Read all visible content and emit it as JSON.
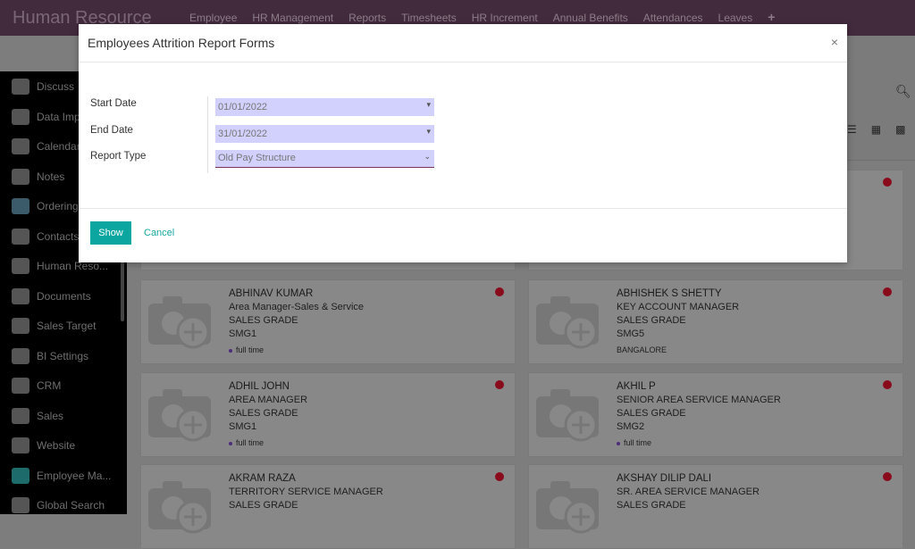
{
  "app": {
    "title": "Human Resource",
    "menu": [
      "Employee",
      "HR Management",
      "Reports",
      "Timesheets",
      "HR Increment",
      "Annual Benefits",
      "Attendances",
      "Leaves"
    ],
    "add_icon": "+"
  },
  "sidebar": {
    "items": [
      {
        "label": "Discuss",
        "icon": "camera-icon"
      },
      {
        "label": "Data Imp",
        "icon": "camera-icon"
      },
      {
        "label": "Calendar",
        "icon": "camera-icon"
      },
      {
        "label": "Notes",
        "icon": "camera-icon"
      },
      {
        "label": "Ordering",
        "icon": "handshake-icon"
      },
      {
        "label": "Contacts",
        "icon": "camera-icon"
      },
      {
        "label": "Human Reso...",
        "icon": "camera-icon"
      },
      {
        "label": "Documents",
        "icon": "camera-icon"
      },
      {
        "label": "Sales Target",
        "icon": "camera-icon"
      },
      {
        "label": "BI Settings",
        "icon": "camera-icon"
      },
      {
        "label": "CRM",
        "icon": "camera-icon"
      },
      {
        "label": "Sales",
        "icon": "camera-icon"
      },
      {
        "label": "Website",
        "icon": "camera-icon"
      },
      {
        "label": "Employee Ma...",
        "icon": "map-pin-icon"
      },
      {
        "label": "Global Search",
        "icon": "camera-icon"
      }
    ]
  },
  "employees": [
    {
      "name": "ABHINAV KUMAR",
      "job": "Area Manager-Sales & Service",
      "grade": "SALES GRADE",
      "code": "SMG1",
      "tag": "full time"
    },
    {
      "name": "ABHISHEK S SHETTY",
      "job": "KEY ACCOUNT MANAGER",
      "grade": "SALES GRADE",
      "code": "SMG5",
      "tag": "BANGALORE"
    },
    {
      "name": "ADHIL JOHN",
      "job": "AREA MANAGER",
      "grade": "SALES GRADE",
      "code": "SMG1",
      "tag": "full time"
    },
    {
      "name": "AKHIL P",
      "job": "SENIOR AREA SERVICE MANAGER",
      "grade": "SALES GRADE",
      "code": "SMG2",
      "tag": "full time"
    },
    {
      "name": "AKRAM RAZA",
      "job": "TERRITORY SERVICE MANAGER",
      "grade": "SALES GRADE",
      "code": "",
      "tag": ""
    },
    {
      "name": "AKSHAY DILIP DALI",
      "job": "SR. AREA SERVICE MANAGER",
      "grade": "SALES GRADE",
      "code": "",
      "tag": ""
    }
  ],
  "modal": {
    "title": "Employees Attrition Report Forms",
    "close": "×",
    "start_label": "Start Date",
    "start_value": "01/01/2022",
    "end_label": "End Date",
    "end_value": "31/01/2022",
    "type_label": "Report Type",
    "type_value": "Old Pay Structure",
    "show": "Show",
    "cancel": "Cancel"
  },
  "colors": {
    "topbar": "#432b3e",
    "primary": "#0ba6a0",
    "status_red": "#8a0b1c"
  }
}
